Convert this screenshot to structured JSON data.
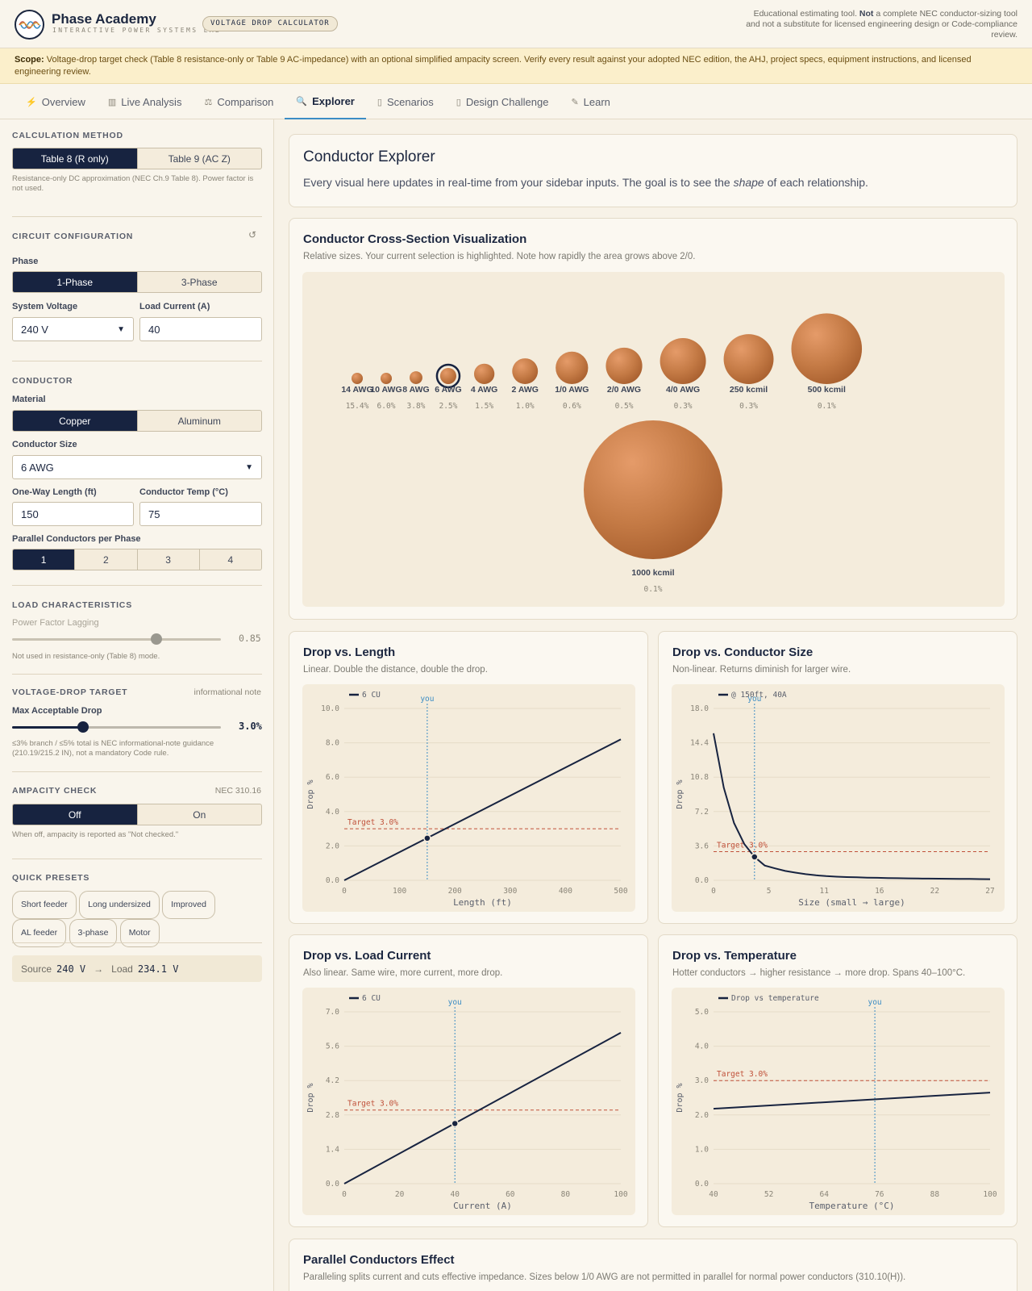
{
  "header": {
    "brand": "Phase Academy",
    "tagline": "INTERACTIVE POWER SYSTEMS LAB",
    "pill": "VOLTAGE DROP CALCULATOR",
    "disclaimer_a": "Educational estimating tool. ",
    "disclaimer_b": "Not",
    "disclaimer_c": " a complete NEC conductor-sizing tool and not a substitute for licensed engineering design or Code-compliance review."
  },
  "scope": {
    "label": "Scope:",
    "text": " Voltage-drop target check (Table 8 resistance-only or Table 9 AC-impedance) with an optional simplified ampacity screen. Verify every result against your adopted NEC edition, the AHJ, project specs, equipment instructions, and licensed engineering review."
  },
  "tabs": [
    {
      "label": "Overview",
      "icon": "⚡"
    },
    {
      "label": "Live Analysis",
      "icon": "▥"
    },
    {
      "label": "Comparison",
      "icon": "⚖"
    },
    {
      "label": "Explorer",
      "icon": "🔍"
    },
    {
      "label": "Scenarios",
      "icon": "▯"
    },
    {
      "label": "Design Challenge",
      "icon": "▯"
    },
    {
      "label": "Learn",
      "icon": "✎"
    }
  ],
  "sidebar": {
    "calc_method": {
      "title": "CALCULATION METHOD",
      "opt1": "Table 8 (R only)",
      "opt2": "Table 9 (AC Z)",
      "note": "Resistance-only DC approximation (NEC Ch.9 Table 8). Power factor is not used."
    },
    "circuit": {
      "title": "CIRCUIT CONFIGURATION",
      "reset_icon": "↺",
      "phase_label": "Phase",
      "phase1": "1-Phase",
      "phase3": "3-Phase",
      "voltage_label": "System Voltage",
      "voltage_value": "240 V",
      "current_label": "Load Current (A)",
      "current_value": "40"
    },
    "conductor": {
      "title": "CONDUCTOR",
      "material_label": "Material",
      "copper": "Copper",
      "aluminum": "Aluminum",
      "size_label": "Conductor Size",
      "size_value": "6 AWG",
      "length_label": "One-Way Length (ft)",
      "length_value": "150",
      "temp_label": "Conductor Temp (°C)",
      "temp_value": "75",
      "parallel_label": "Parallel Conductors per Phase",
      "parallel": [
        "1",
        "2",
        "3",
        "4"
      ]
    },
    "load": {
      "title": "LOAD CHARACTERISTICS",
      "pf_label": "Power Factor Lagging",
      "pf_value": "0.85",
      "pf_fraction": 0.69,
      "note": "Not used in resistance-only (Table 8) mode."
    },
    "target": {
      "title": "VOLTAGE-DROP TARGET",
      "tag": "informational note",
      "label": "Max Acceptable Drop",
      "value": "3.0%",
      "fraction": 0.34,
      "note": "≤3% branch / ≤5% total is NEC informational-note guidance (210.19/215.2 IN), not a mandatory Code rule."
    },
    "ampacity": {
      "title": "AMPACITY CHECK",
      "tag": "NEC 310.16",
      "off": "Off",
      "on": "On",
      "note": "When off, ampacity is reported as \"Not checked.\""
    },
    "presets": {
      "title": "QUICK PRESETS",
      "items": [
        "Short feeder",
        "Long undersized",
        "Improved",
        "AL feeder",
        "3-phase",
        "Motor"
      ]
    },
    "summary": {
      "source_label": "Source",
      "source_value": "240 V",
      "arrow": "→",
      "load_label": "Load",
      "load_value": "234.1 V"
    }
  },
  "main": {
    "explorer": {
      "title": "Conductor Explorer",
      "sub_a": "Every visual here updates in real-time from your sidebar inputs. The goal is to see the ",
      "sub_em": "shape",
      "sub_b": " of each relationship."
    },
    "cross": {
      "title": "Conductor Cross-Section Visualization",
      "sub": "Relative sizes. Your current selection is highlighted. Note how rapidly the area grows above 2/0."
    },
    "parallel": {
      "title": "Parallel Conductors Effect",
      "sub": "Paralleling splits current and cuts effective impedance. Sizes below 1/0 AWG are not permitted in parallel for normal power conductors (310.10(H))."
    }
  },
  "conductors": [
    {
      "name": "14 AWG",
      "pct": "15.4%",
      "area_kcmil": 4.11
    },
    {
      "name": "10 AWG",
      "pct": "6.0%",
      "area_kcmil": 10.38
    },
    {
      "name": "8 AWG",
      "pct": "3.8%",
      "area_kcmil": 16.51
    },
    {
      "name": "6 AWG",
      "pct": "2.5%",
      "area_kcmil": 26.24,
      "selected": true
    },
    {
      "name": "4 AWG",
      "pct": "1.5%",
      "area_kcmil": 41.74
    },
    {
      "name": "2 AWG",
      "pct": "1.0%",
      "area_kcmil": 66.36
    },
    {
      "name": "1/0 AWG",
      "pct": "0.6%",
      "area_kcmil": 105.6
    },
    {
      "name": "2/0 AWG",
      "pct": "0.5%",
      "area_kcmil": 133.1
    },
    {
      "name": "4/0 AWG",
      "pct": "0.3%",
      "area_kcmil": 211.6
    },
    {
      "name": "250 kcmil",
      "pct": "0.3%",
      "area_kcmil": 250
    },
    {
      "name": "500 kcmil",
      "pct": "0.1%",
      "area_kcmil": 500
    },
    {
      "name": "1000 kcmil",
      "pct": "0.1%",
      "area_kcmil": 1000
    }
  ],
  "chart_data": [
    {
      "id": "length",
      "type": "line",
      "title": "Drop vs. Length",
      "subtitle": "Linear. Double the distance, double the drop.",
      "legend": "6 CU",
      "xlabel": "Length (ft)",
      "ylabel": "Drop %",
      "xlim": [
        0,
        500
      ],
      "ylim": [
        0,
        10
      ],
      "xticks": [
        "0",
        "100",
        "200",
        "300",
        "400",
        "500"
      ],
      "yticks": [
        "0.0",
        "2.0",
        "4.0",
        "6.0",
        "8.0",
        "10.0"
      ],
      "x": [
        0,
        500
      ],
      "y": [
        0,
        8.2
      ],
      "target": 3.0,
      "target_label": "Target 3.0%",
      "you_x": 150,
      "you_y": 2.45,
      "you_label": "you"
    },
    {
      "id": "size",
      "type": "line",
      "title": "Drop vs. Conductor Size",
      "subtitle": "Non-linear. Returns diminish for larger wire.",
      "legend": "@ 150ft, 40A",
      "xlabel": "Size (small → large)",
      "ylabel": "Drop %",
      "xlim": [
        0,
        27
      ],
      "ylim": [
        0,
        18
      ],
      "xticks": [
        "0",
        "5",
        "11",
        "16",
        "22",
        "27"
      ],
      "yticks": [
        "0.0",
        "3.6",
        "7.2",
        "10.8",
        "14.4",
        "18.0"
      ],
      "x": [
        0,
        1,
        2,
        3,
        4,
        5,
        6,
        7,
        8,
        9,
        10,
        11,
        12,
        13,
        14,
        15,
        16,
        17,
        18,
        19,
        20,
        21,
        22,
        23,
        24,
        25,
        26,
        27
      ],
      "y": [
        15.4,
        9.7,
        6.0,
        3.8,
        2.45,
        1.55,
        1.25,
        0.98,
        0.8,
        0.64,
        0.52,
        0.44,
        0.38,
        0.34,
        0.31,
        0.28,
        0.26,
        0.24,
        0.22,
        0.2,
        0.19,
        0.18,
        0.17,
        0.16,
        0.15,
        0.14,
        0.13,
        0.12
      ],
      "target": 3.0,
      "target_label": "Target 3.0%",
      "you_x": 4,
      "you_y": 2.45,
      "you_label": "you"
    },
    {
      "id": "current",
      "type": "line",
      "title": "Drop vs. Load Current",
      "subtitle": "Also linear. Same wire, more current, more drop.",
      "legend": "6 CU",
      "xlabel": "Current (A)",
      "ylabel": "Drop %",
      "xlim": [
        0,
        100
      ],
      "ylim": [
        0,
        7
      ],
      "xticks": [
        "0",
        "20",
        "40",
        "60",
        "80",
        "100"
      ],
      "yticks": [
        "0.0",
        "1.4",
        "2.8",
        "4.2",
        "5.6",
        "7.0"
      ],
      "x": [
        0,
        100
      ],
      "y": [
        0,
        6.15
      ],
      "target": 3.0,
      "target_label": "Target 3.0%",
      "you_x": 40,
      "you_y": 2.45,
      "you_label": "you"
    },
    {
      "id": "temp",
      "type": "line",
      "title": "Drop vs. Temperature",
      "subtitle": "Hotter conductors → higher resistance → more drop. Spans 40–100°C.",
      "legend": "Drop vs temperature",
      "xlabel": "Temperature (°C)",
      "ylabel": "Drop %",
      "xlim": [
        40,
        100
      ],
      "ylim": [
        0,
        5
      ],
      "xticks": [
        "40",
        "52",
        "64",
        "76",
        "88",
        "100"
      ],
      "yticks": [
        "0.0",
        "1.0",
        "2.0",
        "3.0",
        "4.0",
        "5.0"
      ],
      "x": [
        40,
        100
      ],
      "y": [
        2.18,
        2.65
      ],
      "target": 3.0,
      "target_label": "Target 3.0%",
      "you_x": 75,
      "you_label": "you"
    }
  ],
  "colors": {
    "navy": "#172340",
    "accent_blue": "#3c8dc4",
    "target_red": "#c0513a",
    "copper": "#c47a45",
    "panel": "#f4ecdc"
  }
}
